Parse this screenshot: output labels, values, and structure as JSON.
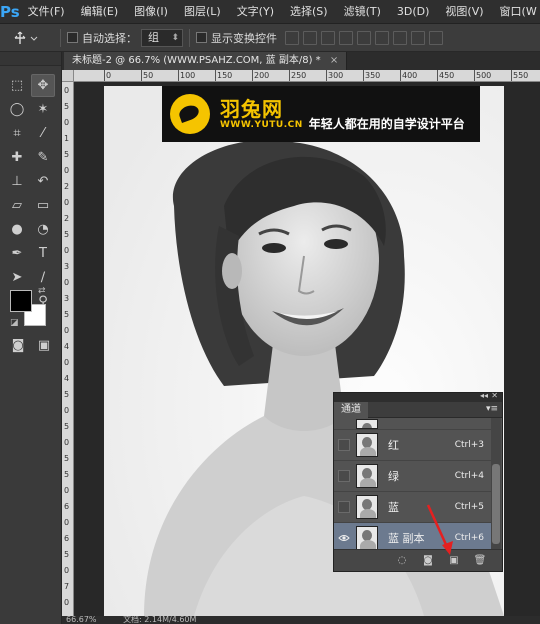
{
  "app": {
    "logo": "Ps"
  },
  "menu": [
    "文件(F)",
    "编辑(E)",
    "图像(I)",
    "图层(L)",
    "文字(Y)",
    "选择(S)",
    "滤镜(T)",
    "3D(D)",
    "视图(V)",
    "窗口(W"
  ],
  "options": {
    "auto_select_label": "自动选择：",
    "auto_select_value": "组",
    "show_transform_label": "显示变换控件"
  },
  "document": {
    "tab_title": "未标题-2 @ 66.7% (WWW.PSAHZ.COM, 蓝 副本/8) *",
    "tab_close": "×"
  },
  "rulers": {
    "top": [
      "0",
      "50",
      "100",
      "150",
      "200",
      "250",
      "300",
      "350",
      "400",
      "450",
      "500",
      "550"
    ],
    "left": [
      "0",
      "5",
      "0",
      "1",
      "5",
      "0",
      "2",
      "0",
      "2",
      "5",
      "0",
      "3",
      "0",
      "3",
      "5",
      "0",
      "4",
      "0",
      "4",
      "5",
      "0",
      "5",
      "0",
      "5",
      "5",
      "0",
      "6",
      "0",
      "6",
      "5",
      "0",
      "7",
      "0"
    ]
  },
  "watermark": {
    "brand": "羽兔网",
    "url": "WWW.YUTU.CN",
    "slogan": "年轻人都在用的自学设计平台"
  },
  "channels_panel": {
    "tab": "通道",
    "rows": [
      {
        "name": "",
        "shortcut": "",
        "partial": true
      },
      {
        "name": "红",
        "shortcut": "Ctrl+3",
        "visible": false
      },
      {
        "name": "绿",
        "shortcut": "Ctrl+4",
        "visible": false
      },
      {
        "name": "蓝",
        "shortcut": "Ctrl+5",
        "visible": false
      },
      {
        "name": "蓝 副本",
        "shortcut": "Ctrl+6",
        "visible": true,
        "selected": true
      }
    ]
  },
  "status": {
    "zoom": "66.67%",
    "doc": "文档: 2.14M/4.60M"
  }
}
